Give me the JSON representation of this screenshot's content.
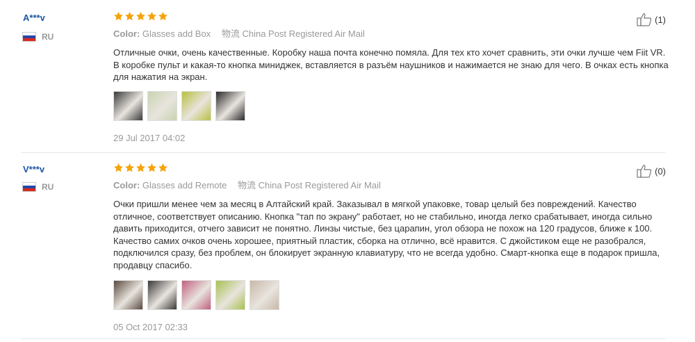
{
  "reviews": [
    {
      "user": "A***v",
      "country": "RU",
      "rating": 5,
      "color_label": "Color:",
      "color_value": "Glasses add Box",
      "shipping_label": "物流",
      "shipping_value": "China Post Registered Air Mail",
      "text": "Отличные очки, очень качественные. Коробку наша почта конечно помяла. Для тех кто хочет сравнить, эти очки лучше чем Fiit VR. В коробке пульт и какая-то кнопка миниджек, вставляется в разъём наушников и нажимается не знаю для чего. В очках есть кнопка для нажатия на экран.",
      "date": "29 Jul 2017 04:02",
      "helpful_count": "(1)",
      "photos": [
        "#3a3a3a",
        "#c8d4b0",
        "#b8c040",
        "#2a2a2a"
      ]
    },
    {
      "user": "V***v",
      "country": "RU",
      "rating": 5,
      "color_label": "Color:",
      "color_value": "Glasses add Remote",
      "shipping_label": "物流",
      "shipping_value": "China Post Registered Air Mail",
      "text": "Очки пришли менее чем за месяц в Алтайский край. Заказывал в мягкой упаковке, товар целый без повреждений. Качество отличное, соответствует описанию. Кнопка \"тап по экрану\" работает, но не стабильно, иногда легко срабатывает, иногда сильно давить приходится, отчего зависит не понятно. Линзы чистые, без царапин, угол обзора не похож на 120 градусов, ближе к 100. Качество самих очков очень хорошее, приятный пластик, сборка на отлично, всё нравится. С джойстиком еще не разобрался, подключился сразу, без проблем, он блокирует экранную клавиатуру, что не всегда удобно. Смарт-кнопка еще в подарок пришла, продавцу спасибо.",
      "date": "05 Oct 2017 02:33",
      "helpful_count": "(0)",
      "photos": [
        "#5a4a40",
        "#3a3838",
        "#c06080",
        "#a8c050",
        "#c8b8a8"
      ]
    }
  ],
  "colors": {
    "username": "#1a56a7",
    "star": "#f5a30a",
    "muted": "#999999"
  }
}
